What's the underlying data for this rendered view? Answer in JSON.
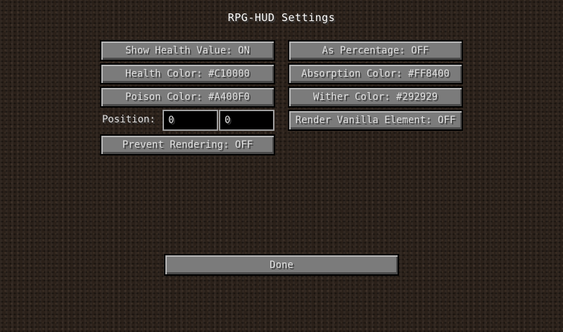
{
  "screen": {
    "title": "RPG-HUD Settings"
  },
  "settings": {
    "show_health_value": "Show Health Value: ON",
    "as_percentage": "As Percentage: OFF",
    "health_color": "Health Color: #C10000",
    "absorption_color": "Absorption Color: #FF8400",
    "poison_color": "Poison Color: #A400F0",
    "wither_color": "Wither Color: #292929",
    "position_label": "Position:",
    "position_x": "0",
    "position_y": "0",
    "render_vanilla_element": "Render Vanilla Element: OFF",
    "prevent_rendering": "Prevent Rendering: OFF"
  },
  "footer": {
    "done_label": "Done"
  },
  "colors": {
    "background": "#2b211a",
    "button_face": "#7b7b7b",
    "button_text": "#e0e0e0",
    "input_background": "#000000",
    "input_border": "#a0a0a0"
  }
}
